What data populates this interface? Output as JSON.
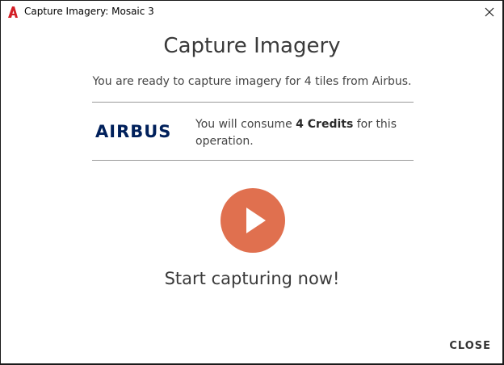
{
  "window": {
    "title": "Capture Imagery: Mosaic 3",
    "app_icon": "autocad-a-icon",
    "close_icon": "close-icon"
  },
  "dialog": {
    "heading": "Capture Imagery",
    "subheading": "You are ready to capture imagery for 4 tiles from Airbus.",
    "provider": {
      "logo_text": "AIRBUS",
      "logo_color": "#00205b"
    },
    "credit": {
      "prefix": "You will consume ",
      "amount": "4 Credits",
      "suffix": " for this operation."
    },
    "play_button": {
      "icon": "play-icon",
      "color": "#e0704f"
    },
    "start_label": "Start capturing now!",
    "close_label": "CLOSE"
  }
}
